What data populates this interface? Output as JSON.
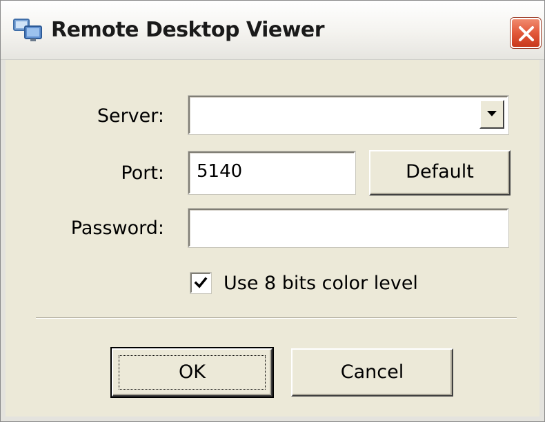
{
  "window": {
    "title": "Remote Desktop Viewer",
    "icon": "remote-desktop-icon",
    "close_icon": "close-icon"
  },
  "form": {
    "server": {
      "label": "Server:",
      "value": "",
      "dropdown_icon": "chevron-down-icon"
    },
    "port": {
      "label": "Port:",
      "value": "5140",
      "default_button": "Default"
    },
    "password": {
      "label": "Password:",
      "value": ""
    },
    "color_option": {
      "label": "Use 8 bits color level",
      "checked": true
    }
  },
  "actions": {
    "ok_label": "OK",
    "cancel_label": "Cancel"
  },
  "colors": {
    "dialog_background": "#ece9d8",
    "close_button": "#e2583a",
    "field_background": "#ffffff"
  }
}
